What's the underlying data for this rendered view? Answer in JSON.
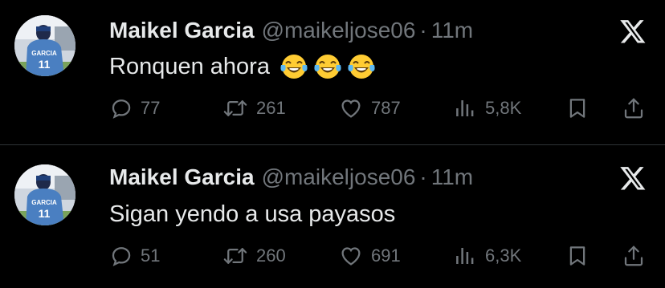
{
  "tweets": [
    {
      "author": "Maikel Garcia",
      "handle": "@maikeljose06",
      "separator": "·",
      "time": "11m",
      "text": "Ronquen ahora",
      "emojis": [
        "face-with-tears-of-joy-icon",
        "face-with-tears-of-joy-icon",
        "face-with-tears-of-joy-icon"
      ],
      "replies": "77",
      "retweets": "261",
      "likes": "787",
      "views": "5,8K",
      "avatar_jersey_name": "GARCIA",
      "avatar_jersey_number": "11"
    },
    {
      "author": "Maikel Garcia",
      "handle": "@maikeljose06",
      "separator": "·",
      "time": "11m",
      "text": "Sigan yendo a usa payasos",
      "emojis": [],
      "replies": "51",
      "retweets": "260",
      "likes": "691",
      "views": "6,3K",
      "avatar_jersey_name": "GARCIA",
      "avatar_jersey_number": "11"
    }
  ],
  "colors": {
    "background": "#000000",
    "text_primary": "#e7e9ea",
    "text_secondary": "#71767b",
    "divider": "#2f3336"
  }
}
